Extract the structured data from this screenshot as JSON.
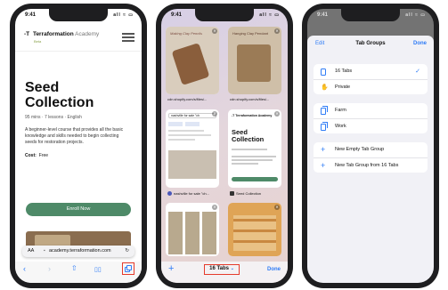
{
  "status": {
    "time": "9:41",
    "signal": "all ≈ ▭"
  },
  "safari": {
    "logo_mark": "-T",
    "brand": "Terraformation",
    "brand_suffix": "Academy",
    "beta": "Beta",
    "title": "Seed Collection",
    "meta": "95 mins · 7 lessons · English",
    "description": "A beginner-level course that provides all the basic knowledge and skills needed to begin collecting seeds for restoration projects.",
    "cost_label": "Cost:",
    "cost_value": "Free",
    "enroll_label": "Enroll Now",
    "address_aa": "AA",
    "address_lock": "🔒",
    "address_url": "academy.terraformation.com",
    "reload_icon": "↻",
    "toolbar": {
      "back": "‹",
      "forward": "›",
      "share": "⇪",
      "bookmarks": "📖"
    }
  },
  "tab_overview": {
    "tabs": [
      {
        "caption": "cdn.shopify.com/s/files/...",
        "thumb_title": "Making Clay Pencils"
      },
      {
        "caption": "cdn.shopify.com/s/files/...",
        "thumb_title": "Hanging Clay Pendant"
      },
      {
        "caption": "nashville for sale \"ch...",
        "search_text": "nashville for sale \"ch"
      },
      {
        "caption": "Seed Collection",
        "thumb_logo": "-T Terraformation Academy",
        "thumb_title": "Seed Collection"
      },
      {
        "caption": ""
      },
      {
        "caption": ""
      }
    ],
    "new_tab_icon": "+",
    "tab_count": "16 Tabs",
    "chevron": "⌄",
    "done": "Done"
  },
  "tab_groups": {
    "edit": "Edit",
    "title": "Tab Groups",
    "done": "Done",
    "group1": [
      {
        "label": "16 Tabs",
        "selected": true,
        "icon": "phone-icon"
      },
      {
        "label": "Private",
        "selected": false,
        "icon": "hand-icon"
      }
    ],
    "group2": [
      {
        "label": "Farm",
        "icon": "tabs-icon"
      },
      {
        "label": "Work",
        "icon": "tabs-icon"
      }
    ],
    "group3": [
      {
        "label": "New Empty Tab Group",
        "icon": "plus-icon"
      },
      {
        "label": "New Tab Group from 16 Tabs",
        "icon": "plus-icon"
      }
    ],
    "checkmark": "✓"
  },
  "colors": {
    "accent": "#2f7cf6",
    "highlight": "#e53b2c",
    "enroll": "#4e8a68"
  }
}
